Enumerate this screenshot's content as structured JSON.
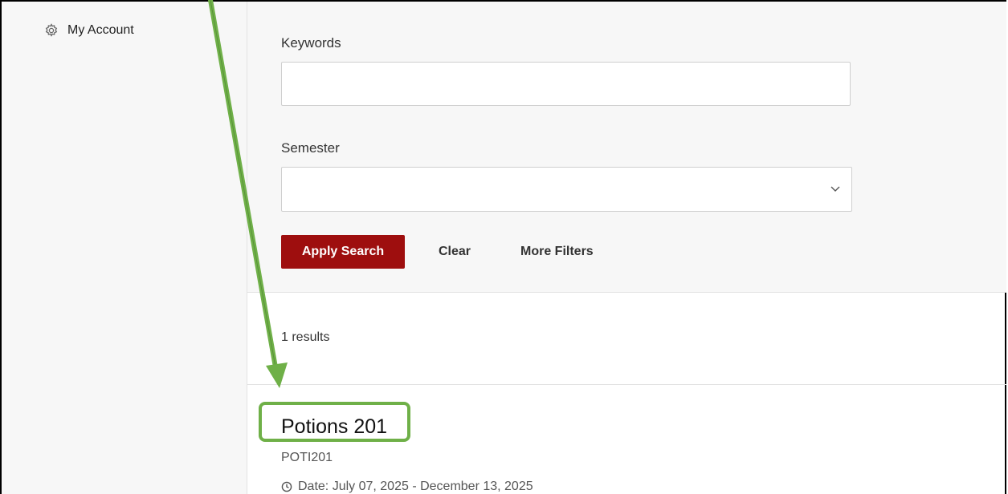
{
  "sidebar": {
    "items": [
      {
        "label": "My Account",
        "icon": "gear-icon"
      }
    ]
  },
  "filters": {
    "keywords_label": "Keywords",
    "keywords_value": "",
    "keywords_placeholder": "",
    "semester_label": "Semester",
    "semester_value": "",
    "apply_label": "Apply Search",
    "clear_label": "Clear",
    "more_label": "More Filters"
  },
  "results": {
    "count_text": "1 results",
    "items": [
      {
        "title": "Potions 201",
        "code": "POTI201",
        "date_text": "Date: July 07, 2025 - December 13, 2025"
      }
    ]
  },
  "annotation": {
    "arrow_color": "#6fb048",
    "highlight_color": "#6fb048"
  },
  "colors": {
    "primary_button": "#9e0e0e",
    "panel_background": "#f7f7f7"
  }
}
